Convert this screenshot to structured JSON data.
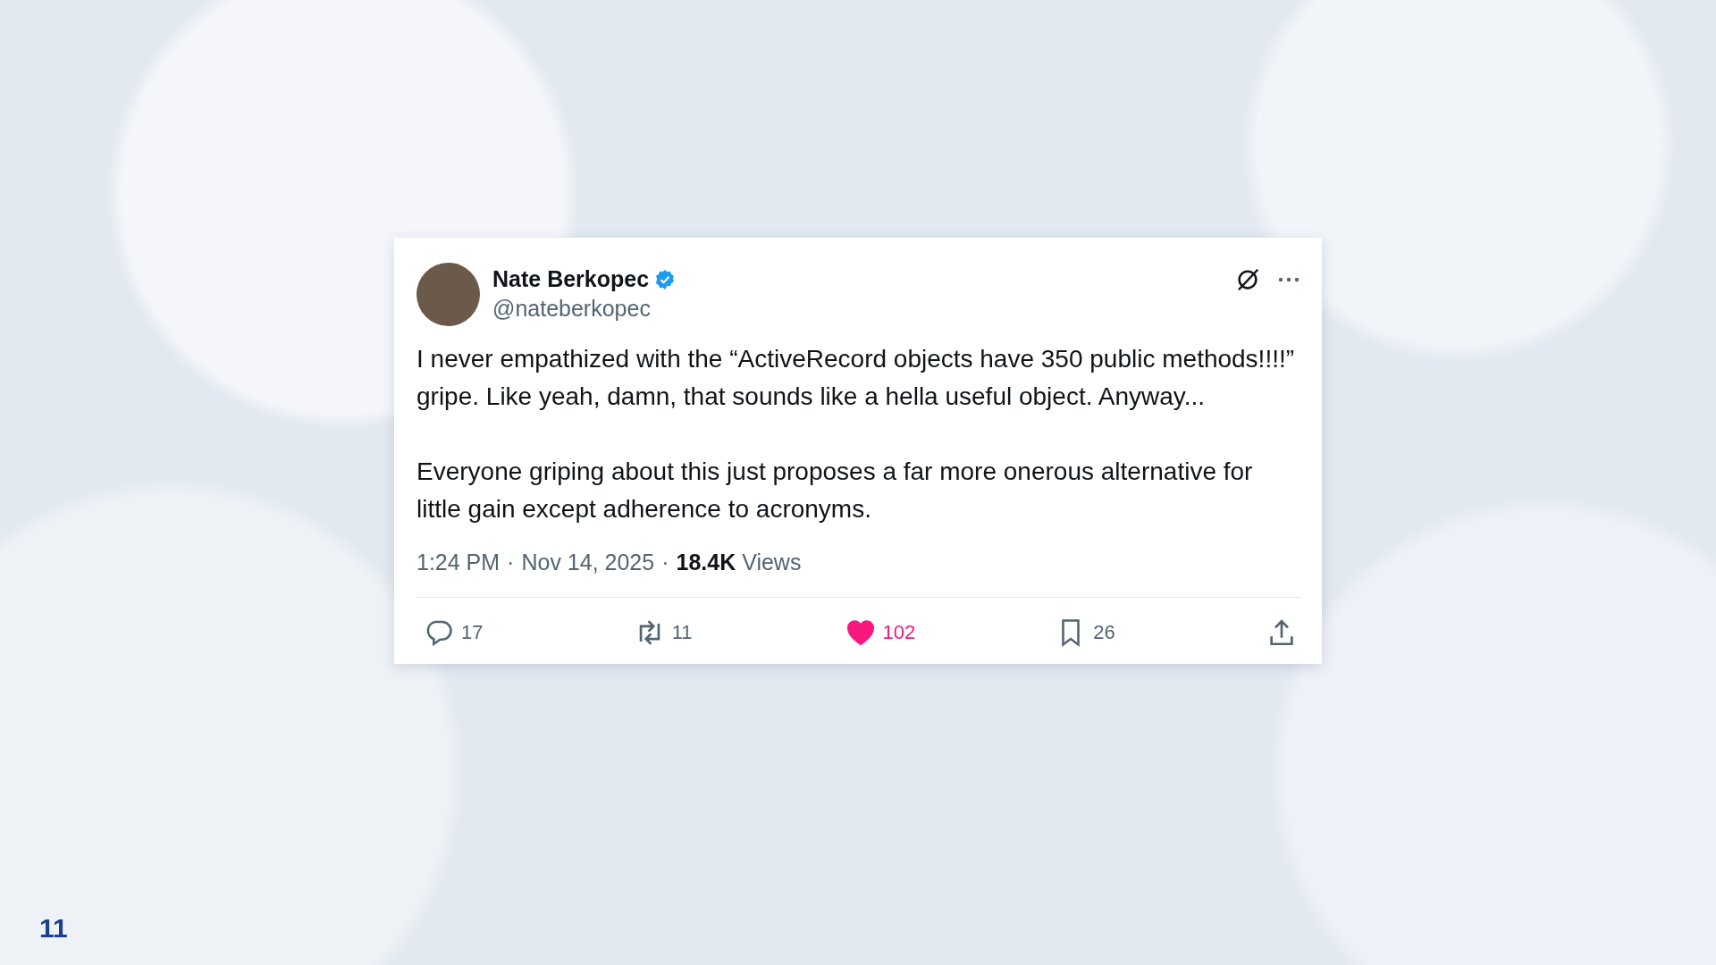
{
  "tweet": {
    "author": {
      "name": "Nate Berkopec",
      "verified": true,
      "handle": "@nateberkopec"
    },
    "paragraphs": [
      "I never empathized with the “ActiveRecord objects have 350 public methods!!!!” gripe. Like yeah, damn, that sounds like a hella useful object. Anyway...",
      "Everyone griping about this just proposes a far more onerous alternative for little gain except adherence to acronyms."
    ],
    "meta": {
      "time": "1:24 PM",
      "separator_1": "·",
      "date": "Nov 14, 2025",
      "separator_2": "·",
      "views_count": "18.4K",
      "views_label": "Views"
    },
    "actions": [
      {
        "kind": "reply",
        "count": "17",
        "on": false
      },
      {
        "kind": "repost",
        "count": "11",
        "on": false
      },
      {
        "kind": "like",
        "count": "102",
        "on": true
      },
      {
        "kind": "bookmark",
        "count": "26",
        "on": false
      },
      {
        "kind": "share",
        "on": false
      }
    ]
  },
  "slide_number": "11"
}
